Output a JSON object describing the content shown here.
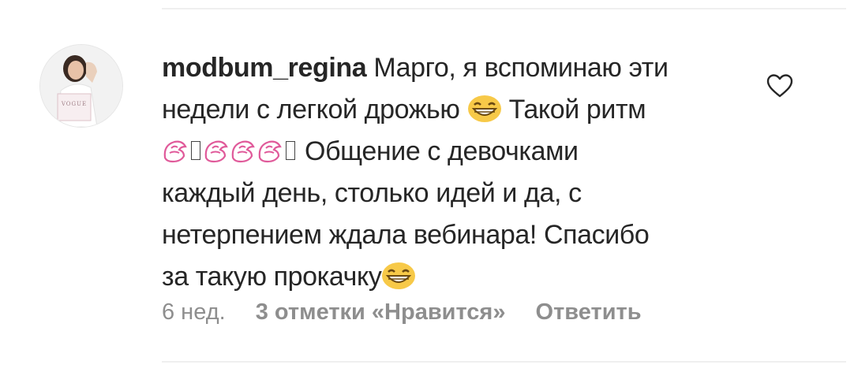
{
  "comment": {
    "username": "modbum_regina",
    "text_line_1": "Марго, я вспоминаю эти",
    "text_line_2": "недели с легкой дрожью",
    "text_line_2b": "Такой ритм",
    "text_line_3": "Общение с девочками",
    "text_line_4": "каждый день, столько идей и да, с",
    "text_line_5": "нетерпением ждала вебинара! Спасибо",
    "text_line_6": "за такую прокачку",
    "emojis": [
      "grinning-face-icon",
      "flexed-biceps-icon",
      "missing-glyph",
      "flexed-biceps-icon",
      "missing-glyph",
      "flexed-biceps-icon",
      "flexed-biceps-icon",
      "missing-glyph",
      "grinning-face-icon"
    ]
  },
  "avatar": {
    "logo_text": "VOGUE"
  },
  "meta": {
    "time": "6 нед.",
    "likes": "3 отметки «Нравится»",
    "reply": "Ответить"
  },
  "colors": {
    "text": "#262626",
    "muted": "#8e8e8e",
    "divider": "#efefef",
    "emoji_yellow": "#f7c948",
    "biceps_pink": "#e05a9a"
  }
}
